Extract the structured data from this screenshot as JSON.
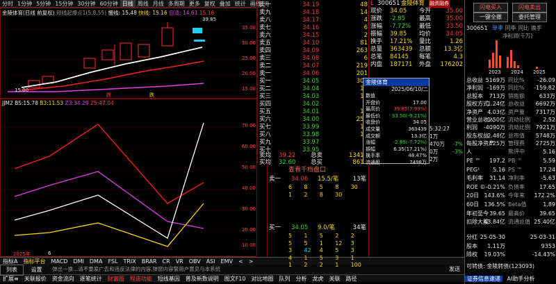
{
  "toolbar": [
    "分时",
    "1分钟",
    "5分钟",
    "15分钟",
    "30分钟",
    "60分钟",
    "日线",
    "周线",
    "月线",
    "多周期",
    "更多",
    "复权",
    "叠加",
    "统计",
    "画线",
    "F10",
    "标记",
    "-",
    "□"
  ],
  "kline": {
    "title": "金陵体育(日线 前复权)",
    "ma_label": "短线起爆点1(5,8,55)",
    "ma1": "慢线: 15.48",
    "ma2": "快线: 15.16",
    "ma3": "自适: 14.61",
    "ma4": "15.16",
    "axis": [
      "35.00",
      "30.00",
      "25.00",
      "20.00",
      "15.00"
    ],
    "price_high": "39.85",
    "price_low": "15.00",
    "marks": [
      "跌",
      "跌"
    ]
  },
  "indicator": {
    "title": "JJM2",
    "v1": "BS:15.78",
    "v2": "B3:11.53",
    "v3": "Z3:34.29",
    "v4": "Z5:47.04",
    "axis": [
      "70.00",
      "60.00",
      "50.00",
      "40.00",
      "30.00",
      "20.00",
      "10.00"
    ],
    "year": "2025年",
    "x6": "6"
  },
  "tabs": [
    "指标A",
    "指标平台",
    "MACD",
    "DMI",
    "DMA",
    "FSL",
    "TRIX",
    "BRAR",
    "CR",
    "VR",
    "OBV",
    "ASI",
    "EMV",
    "<",
    ">"
  ],
  "status1": [
    "扩展≡",
    "关联报价",
    "资金流向",
    "逐笔统计",
    "财富圈",
    "程造功能",
    "短线基因",
    "普及新数说明",
    "图文F10",
    "对比地图"
  ],
  "status2": [
    "队列",
    "分析",
    "龙虎",
    "关联",
    "路径"
  ],
  "cmd": {
    "list": "列表",
    "settings": "设置",
    "tip": "弹出一换...请不要发广告和违反法律的内容,弹窗内容警用户意见与本系统",
    "send": "发送"
  },
  "orderbook": {
    "sells": [
      [
        "卖十",
        "34.19",
        "48"
      ],
      [
        "卖九",
        "34.18",
        "14"
      ],
      [
        "卖八",
        "34.17",
        "4"
      ],
      [
        "卖七",
        "34.16",
        "6"
      ],
      [
        "卖六",
        "34.15",
        "2"
      ],
      [
        "卖五",
        "34.10",
        "81"
      ],
      [
        "卖四",
        "34.09",
        "263"
      ],
      [
        "卖三",
        "34.08",
        "6"
      ],
      [
        "卖二",
        "34.07",
        "219"
      ],
      [
        "卖一",
        "34.06",
        "201"
      ]
    ],
    "buys": [
      [
        "买一",
        "34.05",
        "308"
      ],
      [
        "买二",
        "34.04",
        "17"
      ],
      [
        "买三",
        "34.03",
        "12"
      ],
      [
        "买四",
        "34.02",
        "3"
      ],
      [
        "买五",
        "34.01",
        "10"
      ],
      [
        "买六",
        "34.00",
        "250"
      ],
      [
        "买七",
        "33.99",
        "11"
      ],
      [
        "买八",
        "33.98",
        "10"
      ],
      [
        "买九",
        "33.97",
        "3"
      ],
      [
        "买十",
        "33.95",
        "9"
      ]
    ],
    "avg_sell": "39.22",
    "avg_buy": "32.60",
    "total_sell": "总卖",
    "total_sell_v": "13418",
    "total_buy": "总买",
    "total_buy_v": "8618",
    "depth_title": "查看千档盘口",
    "s1": [
      "卖一",
      "34.06",
      "15.5/笔",
      "13笔"
    ],
    "s1row": [
      "6",
      "8",
      "5",
      "8",
      "30",
      "1",
      "2",
      "8",
      "30"
    ],
    "b1": [
      "买一",
      "34.05",
      "9.0/笔",
      "34笔"
    ],
    "b1rows": [
      [
        "5",
        "1",
        "5",
        "2",
        "2"
      ],
      [
        "5",
        "5",
        "1",
        "12",
        "3"
      ],
      [
        "3",
        "42",
        "4",
        "5",
        "3"
      ],
      [
        "4",
        "1",
        "5",
        "3",
        "1"
      ],
      [
        "1",
        "2",
        "2",
        "1",
        "100"
      ]
    ]
  },
  "quote": {
    "code": "300651",
    "name": "金陵体育",
    "tag": "融资融券",
    "rows": [
      [
        "现价",
        "34.05",
        "今开",
        "35.00"
      ],
      [
        "涨跌",
        "-2.85",
        "最高",
        "35.00"
      ],
      [
        "涨幅",
        "-7.72%",
        "最低",
        "33.50"
      ],
      [
        "振幅",
        "39.85",
        "均价",
        "34.05"
      ],
      [
        "换手",
        "17.21%",
        "量比",
        "1.26"
      ],
      [
        "总量",
        "363439",
        "总额",
        "13.3亿"
      ],
      [
        "总笔",
        "84145",
        "每笔",
        "4.3"
      ],
      [
        "内盘",
        "187171",
        "外盘",
        "176202"
      ]
    ]
  },
  "popup": {
    "title": "金陵体育",
    "date": "2025/06/10/二",
    "rows": [
      [
        "数值",
        ""
      ],
      [
        "开盘价",
        "17.00"
      ],
      [
        "最高价",
        "39.85(7.99%)"
      ],
      [
        "最低价",
        "33.50(-9.21%)"
      ],
      [
        "收盘价",
        "34.05"
      ],
      [
        "成交量",
        "363439"
      ],
      [
        "成交额",
        "13.3亿"
      ],
      [
        "涨幅",
        "-2.85(-7.72%)"
      ],
      [
        "振幅",
        "6.35(17.21%)"
      ],
      [
        "换手率",
        "48.47%"
      ],
      [
        "流通股",
        "7498万"
      ]
    ]
  },
  "ticks": [
    [
      "5:32:27",
      ""
    ],
    [
      "1万",
      ""
    ],
    [
      "470万",
      "-7%"
    ],
    [
      "0万",
      "-3%"
    ],
    [
      "2万",
      ""
    ]
  ],
  "right": {
    "btn_buy": "闪电买入",
    "btn_sell": "闪电卖出",
    "btn_order": "一键全撤",
    "btn_entrust": "委托管理",
    "code": "300651",
    "tabs": [
      "单季",
      "同季",
      "同比",
      "换手"
    ],
    "chart_title": "净利润(千万)",
    "years": [
      "2023",
      "2024",
      "2025"
    ],
    "fin": [
      [
        "总收益",
        "5169万",
        "同比%",
        "-26.09"
      ],
      [
        "净利润",
        "-169万",
        "同比%",
        "-159.82"
      ],
      [
        "总股本",
        "713万",
        "销售额",
        "633万"
      ],
      [
        "股权方式",
        "1.24亿",
        "总收益",
        "6692万"
      ],
      [
        "净资产",
        "4.03亿",
        "资产量",
        "7317万"
      ],
      [
        "营业总收入",
        "1.50亿",
        "流动比例",
        "2.52"
      ],
      [
        "利润",
        "-4090万",
        "流动比例",
        "7921万"
      ],
      [
        "股东权益",
        "2.48亿",
        "总市值",
        "5748万"
      ],
      [
        "每股净资产",
        "125万",
        "管理费",
        "2725万"
      ],
      [
        "人",
        "",
        "熊评中",
        "5.16"
      ]
    ],
    "valuation": [
      [
        "PE ™",
        "197.2",
        "PB ™",
        "5.59"
      ],
      [
        "PEG¹",
        "5.16",
        "PS ™",
        "17.24"
      ],
      [
        "毛利率",
        "31.14",
        "净利率",
        "-5.63"
      ],
      [
        "ROE ©",
        "-0.21%",
        "负债率",
        "17.65"
      ],
      [
        "20日",
        "143.6%",
        "今年来",
        "172.2%"
      ],
      [
        "60日",
        "136.5%",
        "Beta值",
        "1.89"
      ],
      [
        "年初至今",
        "39.65",
        "最高价",
        "39.65"
      ],
      [
        "扣除大股",
        "43.84亿",
        "流通总值",
        "25.40亿"
      ]
    ],
    "div": [
      [
        "分红",
        "25-05-30",
        "",
        "25-03-31"
      ],
      [
        "股本",
        "1.11万",
        "",
        "9353"
      ],
      [
        "除权",
        "19.03%",
        "",
        "-14.43%"
      ]
    ],
    "bond": "可转债: 金陵转债(123093)",
    "bottom": [
      "证券信息速递",
      "AI助手分析"
    ]
  }
}
